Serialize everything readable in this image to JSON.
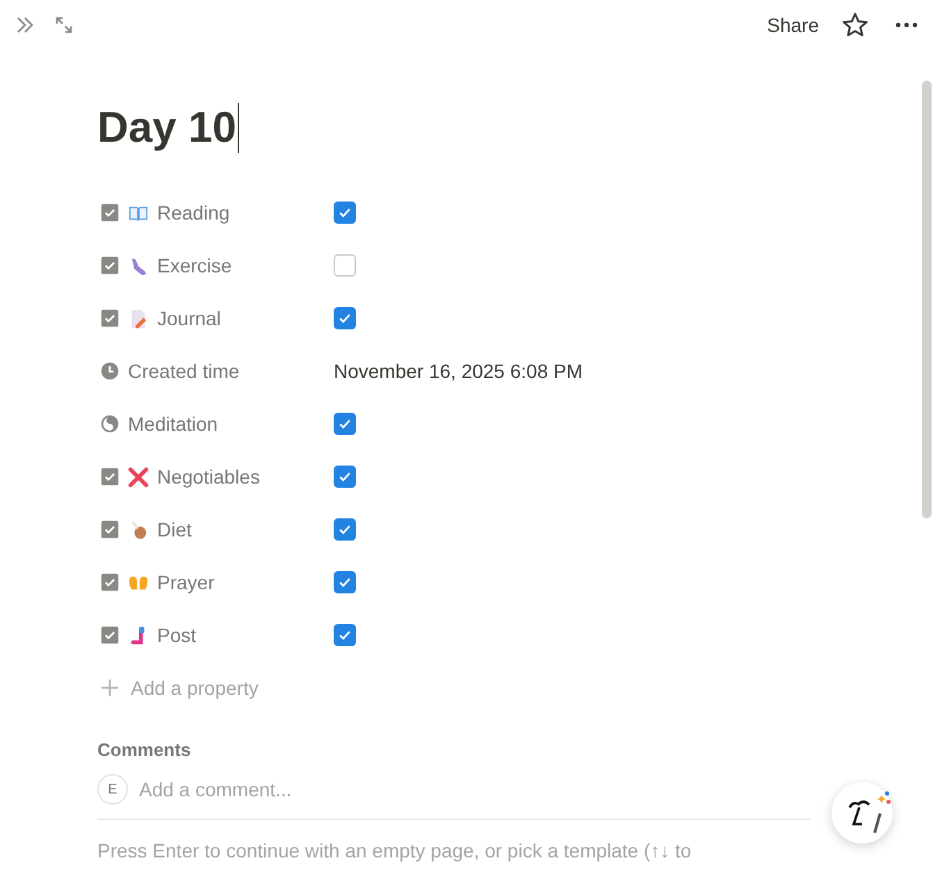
{
  "topbar": {
    "share": "Share"
  },
  "title": "Day 10",
  "properties": [
    {
      "name": "Reading",
      "kind": "checkbox",
      "checked": true
    },
    {
      "name": "Exercise",
      "kind": "checkbox",
      "checked": false
    },
    {
      "name": "Journal",
      "kind": "checkbox",
      "checked": true
    },
    {
      "name": "Created time",
      "kind": "date",
      "value": "November 16, 2025 6:08 PM"
    },
    {
      "name": "Meditation",
      "kind": "checkbox",
      "checked": true
    },
    {
      "name": "Negotiables",
      "kind": "checkbox",
      "checked": true
    },
    {
      "name": "Diet",
      "kind": "checkbox",
      "checked": true
    },
    {
      "name": "Prayer",
      "kind": "checkbox",
      "checked": true
    },
    {
      "name": "Post",
      "kind": "checkbox",
      "checked": true
    }
  ],
  "add_property": "Add a property",
  "comments": {
    "heading": "Comments",
    "avatar": "E",
    "placeholder": "Add a comment..."
  },
  "hint": "Press Enter to continue with an empty page, or pick a template (↑↓ to"
}
